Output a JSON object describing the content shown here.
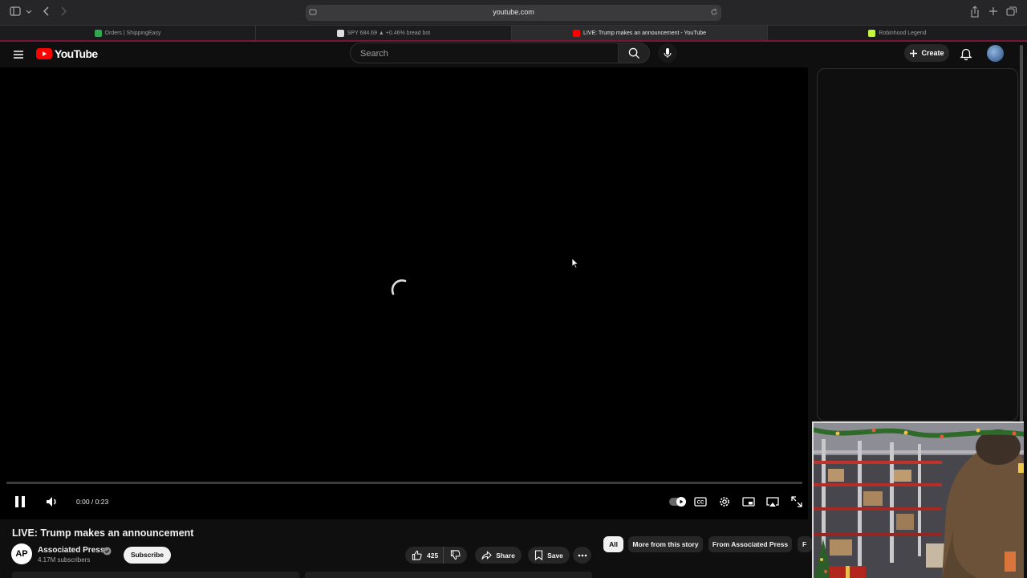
{
  "browser": {
    "address": "youtube.com",
    "tabs": [
      {
        "label": "Orders | ShippingEasy",
        "favicon_color": "#2fa84f",
        "active": false
      },
      {
        "label": "SPY 684.69 ▲ +0.46% bread bot",
        "favicon_color": "#dddddd",
        "active": false
      },
      {
        "label": "LIVE: Trump makes an announcement - YouTube",
        "favicon_color": "#ff0000",
        "active": true
      },
      {
        "label": "Robinhood Legend",
        "favicon_color": "#c3f53c",
        "active": false
      }
    ]
  },
  "masthead": {
    "logo_text": "YouTube",
    "search_placeholder": "Search",
    "create_label": "Create"
  },
  "player": {
    "time": "0:00 / 0:23",
    "progress": 0,
    "state": "loading",
    "autoplay": true
  },
  "video": {
    "title": "LIVE: Trump makes an announcement",
    "channel": {
      "name": "Associated Press",
      "avatar_text": "AP",
      "subscribers": "4.17M subscribers",
      "verified": true
    },
    "subscribe_label": "Subscribe",
    "likes": "425",
    "share_label": "Share",
    "save_label": "Save"
  },
  "chips": [
    {
      "label": "All",
      "active": true
    },
    {
      "label": "More from this story",
      "active": false
    },
    {
      "label": "From Associated Press",
      "active": false
    },
    {
      "label": "F",
      "active": false
    }
  ],
  "colors": {
    "youtube_red": "#ff0000",
    "background": "#0f0f0f",
    "tab_accent": "#7a1538"
  }
}
